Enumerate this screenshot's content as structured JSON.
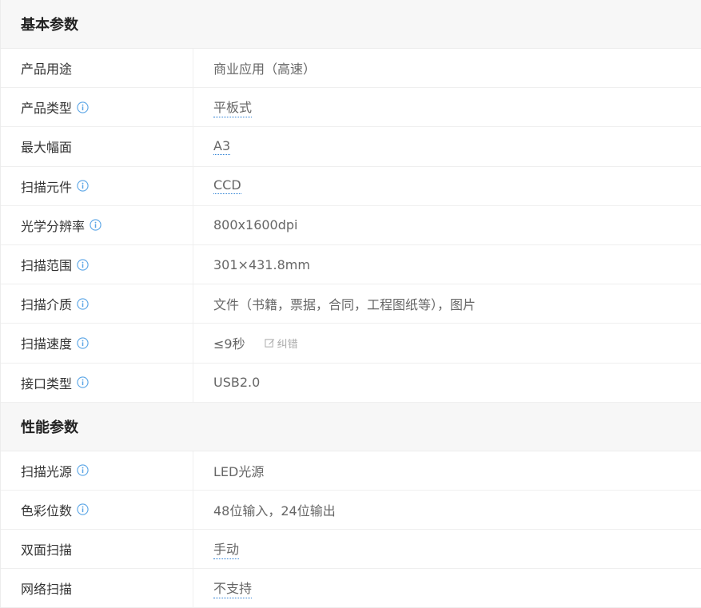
{
  "sections": [
    {
      "title": "基本参数",
      "rows": [
        {
          "label": "产品用途",
          "value": "商业应用（高速）",
          "info": false,
          "link": false
        },
        {
          "label": "产品类型",
          "value": "平板式",
          "info": true,
          "link": true
        },
        {
          "label": "最大幅面",
          "value": "A3",
          "info": false,
          "link": true
        },
        {
          "label": "扫描元件",
          "value": "CCD",
          "info": true,
          "link": true
        },
        {
          "label": "光学分辨率",
          "value": "800x1600dpi",
          "info": true,
          "link": false
        },
        {
          "label": "扫描范围",
          "value": "301×431.8mm",
          "info": true,
          "link": false
        },
        {
          "label": "扫描介质",
          "value": "文件（书籍，票据，合同，工程图纸等），图片",
          "info": true,
          "link": false
        },
        {
          "label": "扫描速度",
          "value": "≤9秒",
          "info": true,
          "link": false,
          "action": "纠错"
        },
        {
          "label": "接口类型",
          "value": "USB2.0",
          "info": true,
          "link": false
        }
      ]
    },
    {
      "title": "性能参数",
      "rows": [
        {
          "label": "扫描光源",
          "value": "LED光源",
          "info": true,
          "link": false
        },
        {
          "label": "色彩位数",
          "value": "48位输入，24位输出",
          "info": true,
          "link": false
        },
        {
          "label": "双面扫描",
          "value": "手动",
          "info": false,
          "link": true
        },
        {
          "label": "网络扫描",
          "value": "不支持",
          "info": false,
          "link": true
        }
      ]
    }
  ],
  "colors": {
    "link_underline": "#2a7fd4",
    "info_icon": "#5aa5e6",
    "header_bg": "#f7f7f7"
  }
}
